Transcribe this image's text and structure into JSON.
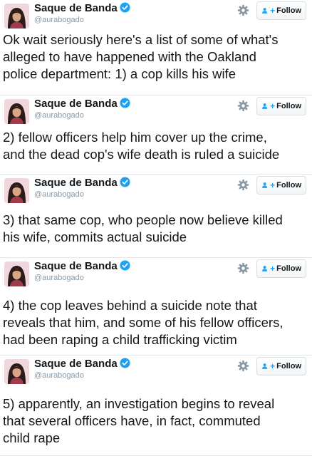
{
  "tweets": [
    {
      "name": "Saque de Banda",
      "handle": "@aurabogado",
      "follow_label": "Follow",
      "lines": [
        "Ok wait seriously here's a list of some of what's",
        "alleged to have happened with the Oakland",
        "police department: 1) a cop kills his wife"
      ]
    },
    {
      "name": "Saque de Banda",
      "handle": "@aurabogado",
      "follow_label": "Follow",
      "lines": [
        "2) fellow officers help him cover up the crime,",
        "and the dead cop's wife death is ruled a suicide"
      ]
    },
    {
      "name": "Saque de Banda",
      "handle": "@aurabogado",
      "follow_label": "Follow",
      "lines": [
        "3) that same cop, who people now believe killed",
        "his wife, commits actual suicide"
      ]
    },
    {
      "name": "Saque de Banda",
      "handle": "@aurabogado",
      "follow_label": "Follow",
      "lines": [
        "4) the cop leaves behind a suicide note that",
        "reveals that him, and some of his fellow officers,",
        "had been raping a child trafficking victim"
      ]
    },
    {
      "name": "Saque de Banda",
      "handle": "@aurabogado",
      "follow_label": "Follow",
      "lines": [
        "5) apparently, an investigation begins to reveal",
        "that several officers have, in fact, commuted",
        "child rape"
      ]
    }
  ],
  "colors": {
    "verified": "#1da1f2",
    "handle": "#8899a6",
    "follow_accent": "#1da1f2"
  },
  "icons": {
    "verified": "verified-badge-icon",
    "settings": "gear-icon",
    "follow": "add-person-icon"
  }
}
